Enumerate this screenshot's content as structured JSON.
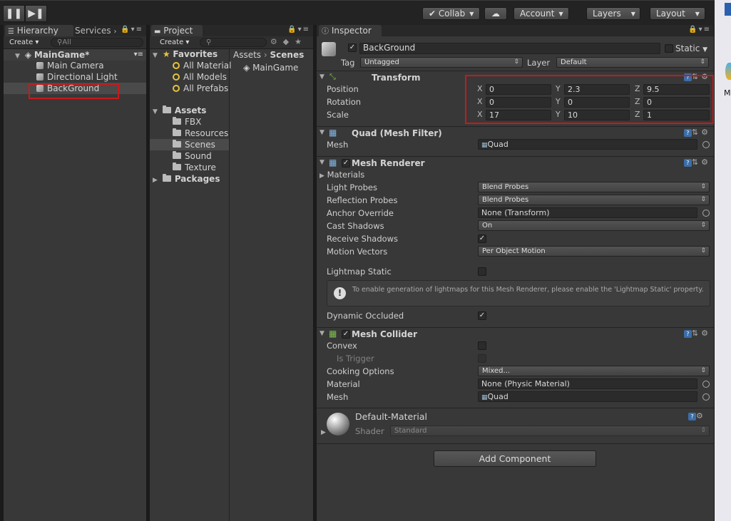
{
  "toolbar": {
    "pause_icon": "pause-icon",
    "step_icon": "step-icon",
    "collab": "Collab",
    "cloud_icon": "cloud-icon",
    "account": "Account",
    "layers": "Layers",
    "layout": "Layout"
  },
  "hierarchy": {
    "tab": "Hierarchy",
    "services_tab": "Services",
    "create": "Create",
    "search_placeholder": "All",
    "scene": "MainGame*",
    "items": [
      "Main Camera",
      "Directional Light",
      "BackGround"
    ]
  },
  "project": {
    "tab": "Project",
    "create": "Create",
    "favorites_label": "Favorites",
    "favorites": [
      "All Material",
      "All Models",
      "All Prefabs"
    ],
    "assets_label": "Assets",
    "asset_folders": [
      "FBX",
      "Resources",
      "Scenes",
      "Sound",
      "Texture"
    ],
    "packages_label": "Packages",
    "breadcrumb_root": "Assets",
    "breadcrumb_current": "Scenes",
    "files": [
      "MainGame"
    ]
  },
  "inspector": {
    "tab": "Inspector",
    "object_name": "BackGround",
    "static_label": "Static",
    "tag_label": "Tag",
    "tag_value": "Untagged",
    "layer_label": "Layer",
    "layer_value": "Default",
    "transform": {
      "title": "Transform",
      "position_label": "Position",
      "rotation_label": "Rotation",
      "scale_label": "Scale",
      "position": [
        "0",
        "2.3",
        "9.5"
      ],
      "rotation": [
        "0",
        "0",
        "0"
      ],
      "scale": [
        "17",
        "10",
        "1"
      ],
      "axes": [
        "X",
        "Y",
        "Z"
      ]
    },
    "mesh_filter": {
      "title": "Quad (Mesh Filter)",
      "mesh_label": "Mesh",
      "mesh_value": "Quad"
    },
    "mesh_renderer": {
      "title": "Mesh Renderer",
      "materials_label": "Materials",
      "light_probes_label": "Light Probes",
      "light_probes_value": "Blend Probes",
      "reflection_probes_label": "Reflection Probes",
      "reflection_probes_value": "Blend Probes",
      "anchor_override_label": "Anchor Override",
      "anchor_override_value": "None (Transform)",
      "cast_shadows_label": "Cast Shadows",
      "cast_shadows_value": "On",
      "receive_shadows_label": "Receive Shadows",
      "motion_vectors_label": "Motion Vectors",
      "motion_vectors_value": "Per Object Motion",
      "lightmap_static_label": "Lightmap Static",
      "info_text": "To enable generation of lightmaps for this Mesh Renderer, please enable the 'Lightmap Static' property.",
      "dynamic_occluded_label": "Dynamic Occluded"
    },
    "mesh_collider": {
      "title": "Mesh Collider",
      "convex_label": "Convex",
      "is_trigger_label": "Is Trigger",
      "cooking_options_label": "Cooking Options",
      "cooking_options_value": "Mixed...",
      "material_label": "Material",
      "material_value": "None (Physic Material)",
      "mesh_label": "Mesh",
      "mesh_value": "Quad"
    },
    "material": {
      "name": "Default-Material",
      "shader_label": "Shader",
      "shader_value": "Standard"
    },
    "add_component": "Add Component"
  },
  "right_edge": {
    "letter": "M"
  },
  "colors": {
    "highlight_red": "#c8191b",
    "panel_bg": "#383838",
    "accent_blue": "#3b6ea8"
  }
}
